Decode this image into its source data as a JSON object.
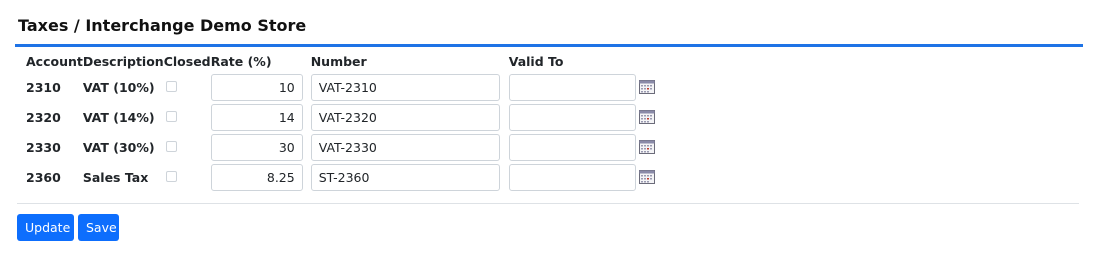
{
  "page": {
    "title": "Taxes / Interchange Demo Store"
  },
  "table": {
    "headers": {
      "account": "Account",
      "description": "Description",
      "closed": "Closed",
      "rate": "Rate (%)",
      "number": "Number",
      "valid_to": "Valid To"
    },
    "rows": [
      {
        "account": "2310",
        "description": "VAT (10%)",
        "closed": false,
        "rate": "10",
        "number": "VAT-2310",
        "valid_to": ""
      },
      {
        "account": "2320",
        "description": "VAT (14%)",
        "closed": false,
        "rate": "14",
        "number": "VAT-2320",
        "valid_to": ""
      },
      {
        "account": "2330",
        "description": "VAT (30%)",
        "closed": false,
        "rate": "30",
        "number": "VAT-2330",
        "valid_to": ""
      },
      {
        "account": "2360",
        "description": "Sales Tax",
        "closed": false,
        "rate": "8.25",
        "number": "ST-2360",
        "valid_to": ""
      }
    ]
  },
  "actions": {
    "update_label": "Update",
    "save_label": "Save"
  },
  "icons": {
    "calendar": "calendar-icon"
  },
  "colors": {
    "accent": "#1e73e6",
    "button": "#0d6efd"
  }
}
